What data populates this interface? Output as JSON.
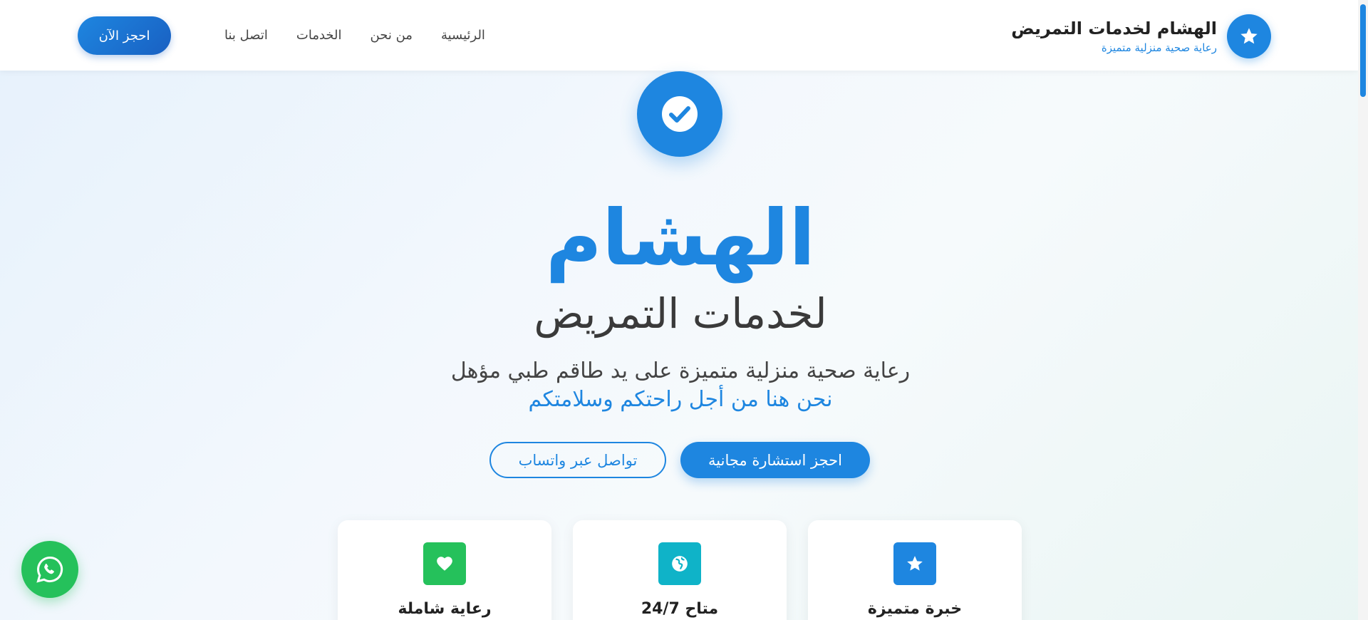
{
  "header": {
    "brand_title": "الهشام لخدمات التمريض",
    "brand_subtitle": "رعاية صحية منزلية متميزة",
    "brand_icon": "star-icon",
    "nav": [
      "الرئيسية",
      "من نحن",
      "الخدمات",
      "اتصل بنا"
    ],
    "book_label": "احجز الآن"
  },
  "hero": {
    "icon": "check-circle-icon",
    "title": "الهشام",
    "subtitle": "لخدمات التمريض",
    "description": "رعاية صحية منزلية متميزة على يد طاقم طبي مؤهل",
    "tagline": "نحن هنا من أجل راحتكم وسلامتكم",
    "primary_button": "احجز استشارة مجانية",
    "secondary_button": "تواصل عبر واتساب"
  },
  "features": [
    {
      "title": "خبرة متميزة",
      "icon": "star-icon",
      "color": "#1e86e0"
    },
    {
      "title": "متاح 24/7",
      "icon": "globe-icon",
      "color": "#0fb3c8"
    },
    {
      "title": "رعاية شاملة",
      "icon": "heart-icon",
      "color": "#25c15b"
    }
  ],
  "whatsapp": {
    "icon": "whatsapp-icon"
  },
  "colors": {
    "accent": "#1e86e0",
    "whatsapp": "#25c15b",
    "teal": "#0fb3c8"
  }
}
